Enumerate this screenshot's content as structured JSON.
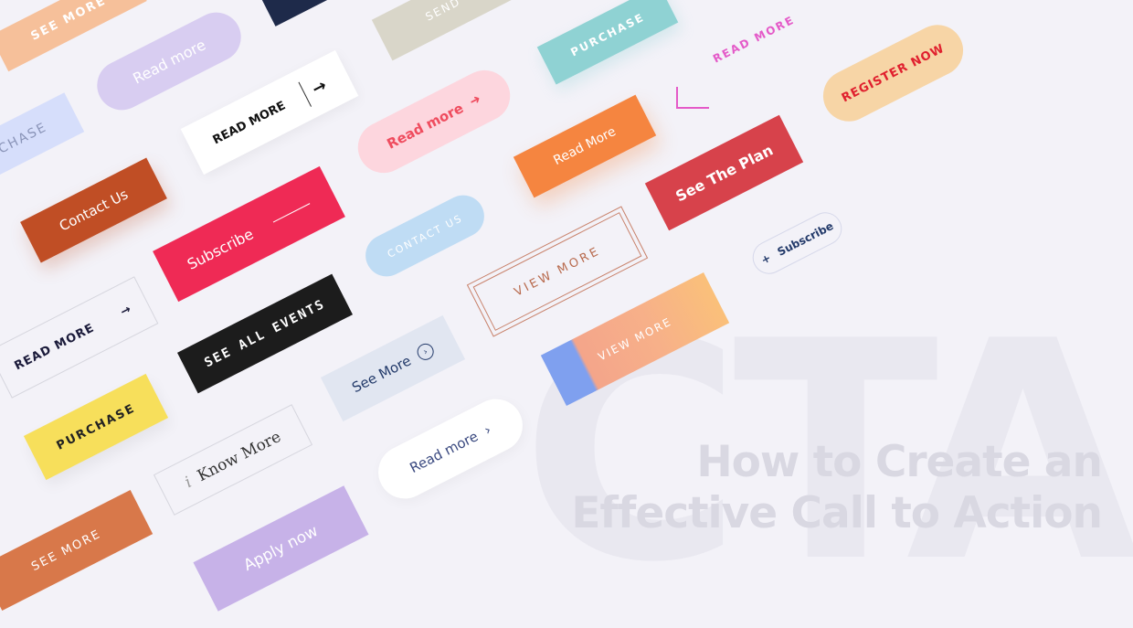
{
  "background_text": "CTA",
  "headline": {
    "line1": "How to Create an",
    "line2": "Effective Call to Action"
  },
  "buttons": {
    "see_more_top": "SEE MORE",
    "read_more_lavender": "Read more",
    "purchase_blue": "PURCHASE",
    "read_more_white": "READ MORE",
    "contact_us_rust": "Contact Us",
    "subscribe_red": "Subscribe",
    "read_more_outline": "READ MORE",
    "see_all_events": "SEE ALL EVENTS",
    "purchase_yellow": "PURCHASE",
    "know_more": "Know More",
    "see_more_bottom": "SEE MORE",
    "apply_now": "Apply now",
    "send": "SEND",
    "read_more_pink": "Read more",
    "contact_us_light": "CONTACT US",
    "see_more_circle": "See More",
    "read_more_pill_white": "Read more",
    "purchase_teal": "PURCHASE",
    "read_more_orange": "Read More",
    "view_more_frame": "VIEW MORE",
    "view_more_brush": "VIEW MORE",
    "read_more_corner": "READ MORE",
    "see_the_plan": "See The Plan",
    "subscribe_small": "Subscribe",
    "register_now": "REGISTER NOW"
  },
  "colors": {
    "peach": "#f6c09a",
    "lavender": "#d8cdf1",
    "navy": "#1e2a4a",
    "rust": "#c04e25",
    "red": "#ef2a55",
    "yellow": "#f7df5b",
    "orange_brown": "#d8784a",
    "purple": "#c7b2e8",
    "beige": "#d9d6c9",
    "pink": "#fdd6de",
    "light_blue": "#bfdcf4",
    "grey_blue": "#e1e6f1",
    "teal": "#8fd2d3",
    "orange": "#f58540",
    "crimson": "#d7424b",
    "sand": "#f7d5a6",
    "magenta": "#e45ac8"
  },
  "icons": [
    "arrow-right-icon",
    "circle-arrow-icon",
    "chevron-right-icon",
    "plus-icon",
    "info-icon"
  ]
}
